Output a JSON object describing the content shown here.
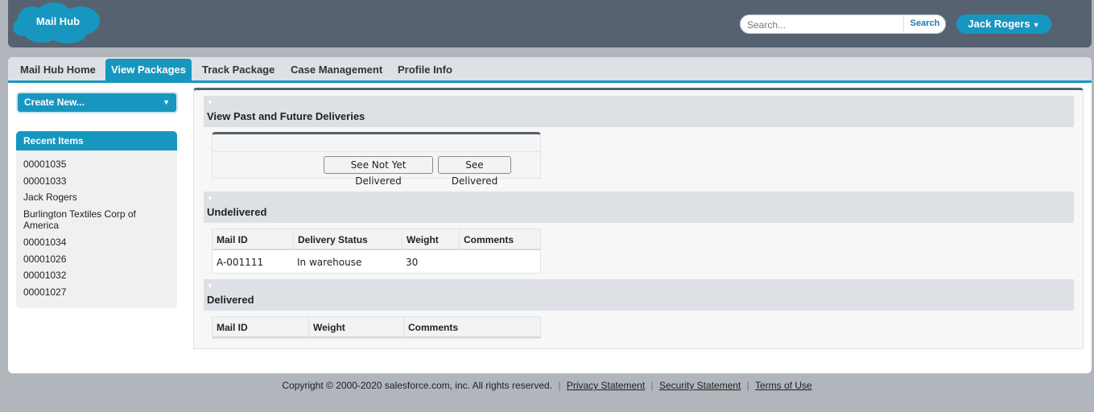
{
  "header": {
    "logo_text": "Mail Hub",
    "search_placeholder": "Search...",
    "search_button": "Search",
    "user_name": "Jack Rogers"
  },
  "tabs": [
    {
      "label": "Mail Hub Home",
      "active": false
    },
    {
      "label": "View Packages",
      "active": true
    },
    {
      "label": "Track Package",
      "active": false
    },
    {
      "label": "Case Management",
      "active": false
    },
    {
      "label": "Profile Info",
      "active": false
    }
  ],
  "sidebar": {
    "create_new": "Create New...",
    "recent_title": "Recent Items",
    "recent_items": [
      "00001035",
      "00001033",
      "Jack Rogers",
      "Burlington Textiles Corp of America",
      "00001034",
      "00001026",
      "00001032",
      "00001027"
    ]
  },
  "main": {
    "deliveries_section": {
      "title": "View Past and Future Deliveries",
      "btn_not_delivered": "See Not Yet Delivered",
      "btn_delivered": "See Delivered"
    },
    "undelivered": {
      "title": "Undelivered",
      "columns": [
        "Mail ID",
        "Delivery Status",
        "Weight",
        "Comments"
      ],
      "rows": [
        {
          "mail_id": "A-001111",
          "status": "In warehouse",
          "weight": "30",
          "comments": ""
        }
      ]
    },
    "delivered": {
      "title": "Delivered",
      "columns": [
        "Mail ID",
        "Weight",
        "Comments"
      ],
      "rows": []
    }
  },
  "footer": {
    "copyright": "Copyright © 2000-2020 salesforce.com, inc. All rights reserved.",
    "links": [
      "Privacy Statement",
      "Security Statement",
      "Terms of Use"
    ]
  },
  "colors": {
    "header_bg": "#566270",
    "accent": "#1797c0",
    "section_bg": "#dde1e5"
  }
}
